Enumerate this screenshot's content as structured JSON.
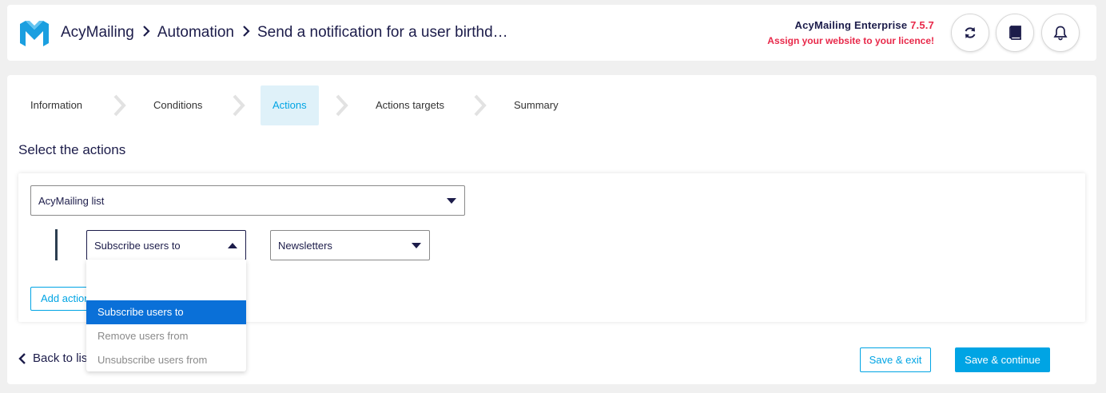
{
  "header": {
    "breadcrumb": [
      "AcyMailing",
      "Automation",
      "Send a notification for a user birthd…"
    ],
    "separator": "›",
    "product_name": "AcyMailing Enterprise",
    "product_version": "7.5.7",
    "licence_warning": "Assign your website to your licence!",
    "buttons": [
      "refresh-icon",
      "documentation-icon",
      "notifications-icon"
    ]
  },
  "steps": [
    {
      "label": "Information",
      "active": false
    },
    {
      "label": "Conditions",
      "active": false
    },
    {
      "label": "Actions",
      "active": true
    },
    {
      "label": "Actions targets",
      "active": false
    },
    {
      "label": "Summary",
      "active": false
    }
  ],
  "section_title": "Select the actions",
  "action": {
    "type_select": "AcyMailing list",
    "mode_select": "Subscribe users to",
    "list_select": "Newsletters"
  },
  "dropdown": {
    "search_value": "",
    "options": [
      {
        "label": "Subscribe users to",
        "selected": true
      },
      {
        "label": "Remove users from",
        "selected": false
      },
      {
        "label": "Unsubscribe users from",
        "selected": false
      }
    ]
  },
  "add_action_label": "Add action",
  "footer": {
    "back_label": "Back to list",
    "save_exit_label": "Save & exit",
    "save_continue_label": "Save & continue"
  },
  "colors": {
    "accent": "#00a4e4",
    "navy": "#1c1c4a",
    "alert": "#e8294a",
    "selected_option": "#0a70d8"
  }
}
